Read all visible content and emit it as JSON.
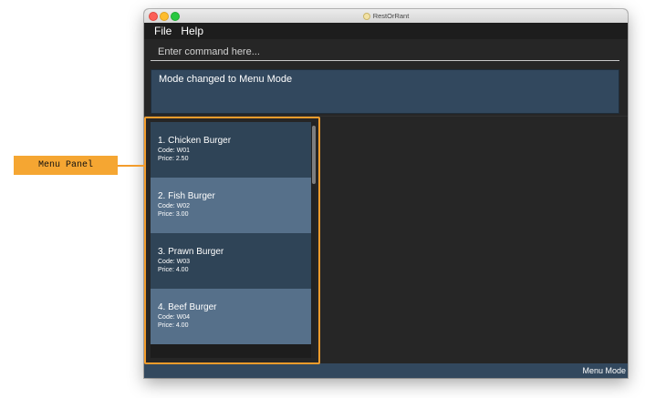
{
  "window": {
    "title": "RestOrRant"
  },
  "menubar": {
    "items": [
      "File",
      "Help"
    ]
  },
  "command": {
    "placeholder": "Enter command here...",
    "value": ""
  },
  "result": {
    "text": "Mode changed to Menu Mode"
  },
  "menu_panel": {
    "items": [
      {
        "name": "1.  Chicken Burger",
        "code": "Code: W01",
        "price": "Price: 2.50"
      },
      {
        "name": "2.  Fish Burger",
        "code": "Code: W02",
        "price": "Price: 3.00"
      },
      {
        "name": "3.  Prawn Burger",
        "code": "Code: W03",
        "price": "Price: 4.00"
      },
      {
        "name": "4.  Beef Burger",
        "code": "Code: W04",
        "price": "Price: 4.00"
      }
    ]
  },
  "status": {
    "mode": "Menu Mode"
  },
  "annotation": {
    "label": "Menu Panel"
  },
  "colors": {
    "accent": "#f39c2c",
    "card_dark": "#2f4457",
    "card_light": "#56708a",
    "status_bar": "#32485e"
  }
}
